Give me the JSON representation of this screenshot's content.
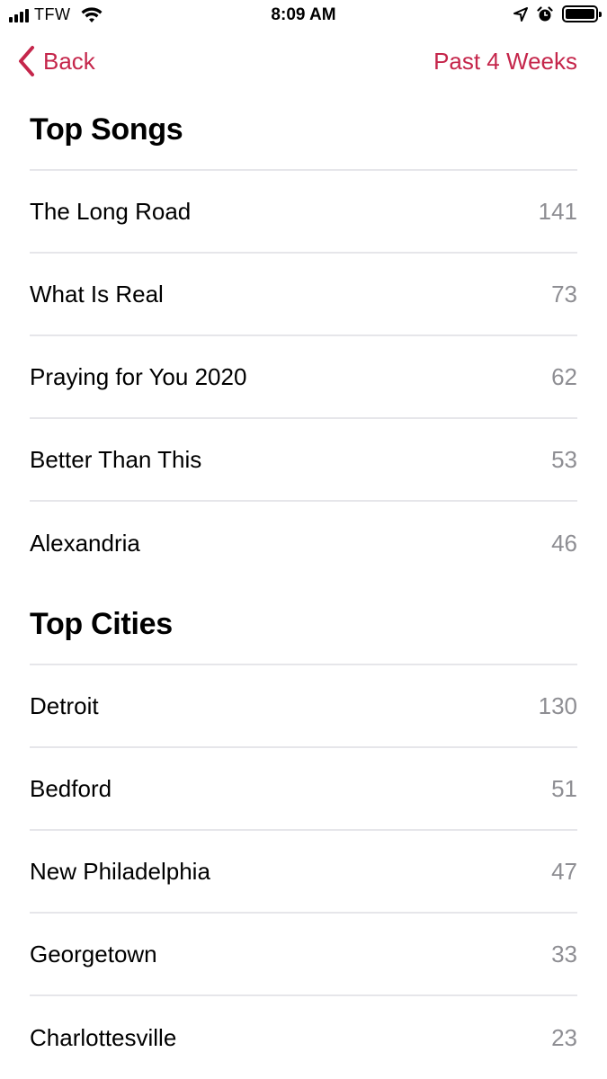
{
  "status_bar": {
    "carrier": "TFW",
    "time": "8:09 AM",
    "icons": [
      "signal-icon",
      "wifi-icon",
      "location-icon",
      "alarm-icon",
      "battery-icon"
    ]
  },
  "nav": {
    "back_label": "Back",
    "range_label": "Past 4 Weeks",
    "accent_color": "#c5264b"
  },
  "sections": [
    {
      "title": "Top Songs",
      "items": [
        {
          "name": "The Long Road",
          "count": "141"
        },
        {
          "name": "What Is Real",
          "count": "73"
        },
        {
          "name": "Praying for You 2020",
          "count": "62"
        },
        {
          "name": "Better Than This",
          "count": "53"
        },
        {
          "name": "Alexandria",
          "count": "46"
        }
      ]
    },
    {
      "title": "Top Cities",
      "items": [
        {
          "name": "Detroit",
          "count": "130"
        },
        {
          "name": "Bedford",
          "count": "51"
        },
        {
          "name": "New Philadelphia",
          "count": "47"
        },
        {
          "name": "Georgetown",
          "count": "33"
        },
        {
          "name": "Charlottesville",
          "count": "23"
        }
      ]
    }
  ]
}
